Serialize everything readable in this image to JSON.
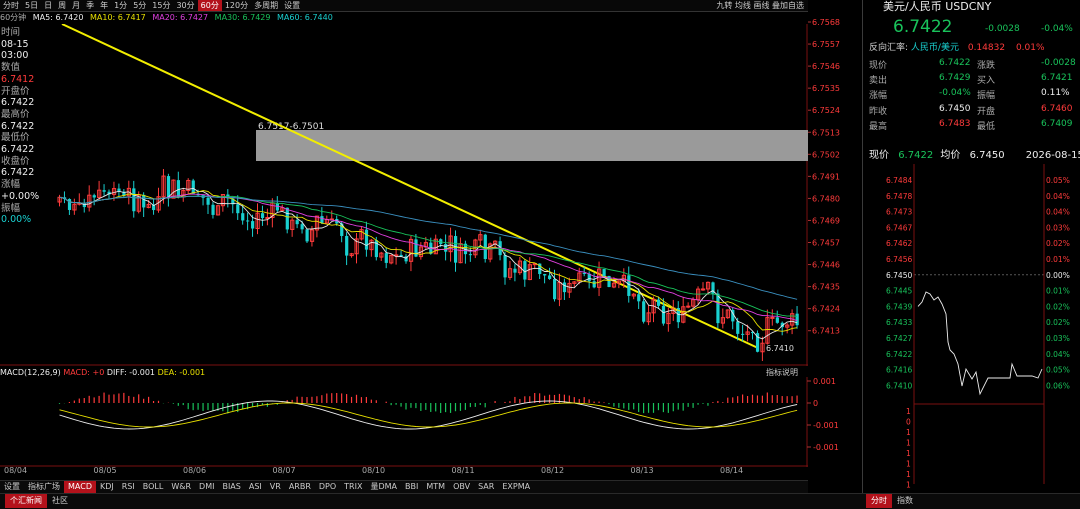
{
  "toolbar": {
    "tabs": [
      "分时",
      "5日",
      "日",
      "周",
      "月",
      "季",
      "年",
      "1分",
      "5分",
      "15分",
      "30分",
      "60分",
      "120分",
      "多周期",
      "设置"
    ],
    "active_tab": "60分",
    "right_tools": "九转  均线  画线  叠加自选"
  },
  "ma_row": {
    "period": "60分钟",
    "ma5": "MA5: 6.7420",
    "ma10": "MA10: 6.7417",
    "ma20": "MA20: 6.7427",
    "ma30": "MA30: 6.7429",
    "ma60": "MA60: 6.7440"
  },
  "left_info": {
    "time_label": "时间",
    "date": "08-15",
    "time": "03:00",
    "value_label": "数值",
    "value": "6.7412",
    "open_label": "开盘价",
    "open": "6.7422",
    "high_label": "最高价",
    "high": "6.7422",
    "low_label": "最低价",
    "low": "6.7422",
    "close_label": "收盘价",
    "close": "6.7422",
    "change_label": "涨幅",
    "change": "+0.00%",
    "amp_label": "振幅",
    "amp": "0.00%"
  },
  "price_axis": [
    "6.7568",
    "6.7557",
    "6.7546",
    "6.7535",
    "6.7524",
    "6.7513",
    "6.7502",
    "6.7491",
    "6.7480",
    "6.7469",
    "6.7457",
    "6.7446",
    "6.7435",
    "6.7424",
    "6.7413"
  ],
  "annotations": {
    "box_label": "6.7517-6.7501",
    "low_label": "6.7410"
  },
  "macd": {
    "label": "MACD(12,26,9)",
    "macd": "MACD: +0",
    "diff": "DIFF: -0.001",
    "dea": "DEA: -0.001",
    "button": "指标说明",
    "axis": [
      "0.001",
      "0",
      "-0.001",
      "-0.001"
    ]
  },
  "dates": [
    "08/04",
    "08/05",
    "08/06",
    "08/07",
    "08/10",
    "08/11",
    "08/12",
    "08/13",
    "08/14"
  ],
  "indicator_tabs": [
    "设置",
    "指标广场",
    "MACD",
    "KDJ",
    "RSI",
    "BOLL",
    "W&R",
    "DMI",
    "BIAS",
    "ASI",
    "VR",
    "ARBR",
    "DPO",
    "TRIX",
    "量DMA",
    "BBI",
    "MTM",
    "OBV",
    "SAR",
    "EXPMA"
  ],
  "indicator_active": "MACD",
  "bottom_tabs": [
    "个汇新闻",
    "社区"
  ],
  "bottom_active": "个汇新闻",
  "bottom_right_tabs": [
    "分时",
    "指数"
  ],
  "bottom_right_active": "分时",
  "quote": {
    "title": "美元/人民币  USDCNY",
    "price": "6.7422",
    "change": "-0.0028",
    "pct": "-0.04%",
    "reverse_label": "反向汇率:",
    "reverse_pair": "人民币/美元",
    "reverse_price": "0.14832",
    "reverse_pct": "0.01%",
    "rows": [
      {
        "l1": "现价",
        "v1": "6.7422",
        "l2": "涨跌",
        "v2": "-0.0028",
        "c1": "green",
        "c2": "green"
      },
      {
        "l1": "卖出",
        "v1": "6.7429",
        "l2": "买入",
        "v2": "6.7421",
        "c1": "green",
        "c2": "green"
      },
      {
        "l1": "涨幅",
        "v1": "-0.04%",
        "l2": "振幅",
        "v2": "0.11%",
        "c1": "green",
        "c2": "white"
      },
      {
        "l1": "昨收",
        "v1": "6.7450",
        "l2": "开盘",
        "v2": "6.7460",
        "c1": "white",
        "c2": "red"
      },
      {
        "l1": "最高",
        "v1": "6.7483",
        "l2": "最低",
        "v2": "6.7409",
        "c1": "red",
        "c2": "green"
      }
    ],
    "mini_header": {
      "label1": "现价",
      "price": "6.7422",
      "label2": "均价",
      "avg": "6.7450",
      "date": "2026-08-15"
    },
    "mini_axis_left": [
      "6.7484",
      "6.7478",
      "6.7473",
      "6.7467",
      "6.7462",
      "6.7456",
      "6.7450",
      "6.7445",
      "6.7439",
      "6.7433",
      "6.7427",
      "6.7422",
      "6.7416",
      "6.7410"
    ],
    "mini_axis_right": [
      "0.05%",
      "0.04%",
      "0.04%",
      "0.03%",
      "0.02%",
      "0.01%",
      "0.00%",
      "0.01%",
      "0.02%",
      "0.02%",
      "0.03%",
      "0.04%",
      "0.05%",
      "0.06%"
    ],
    "mini_vol_axis": [
      "1",
      "0",
      "1",
      "1",
      "1",
      "1",
      "1",
      "1"
    ]
  },
  "colors": {
    "up": "#ff3b3b",
    "down": "#19d0d0",
    "trend": "#e8e000",
    "accent": "#b3121b"
  }
}
